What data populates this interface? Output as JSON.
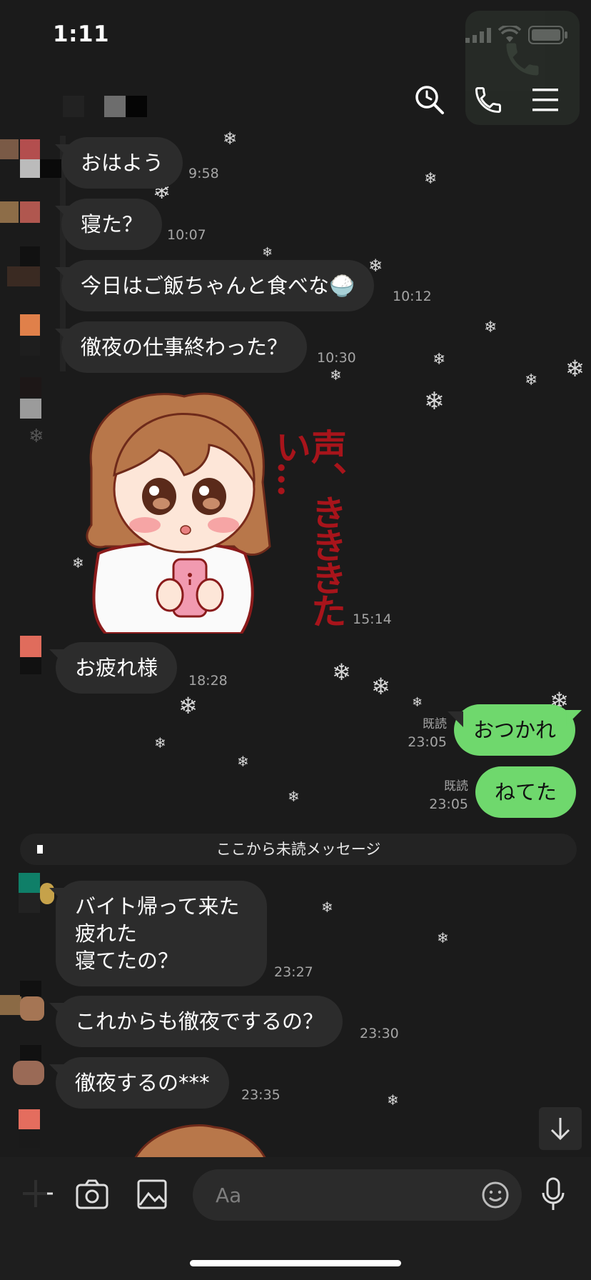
{
  "status_bar": {
    "time": "1:11"
  },
  "chat": {
    "messages_in_top": [
      {
        "text": "おはよう",
        "time": "9:58"
      },
      {
        "text": "寝た？",
        "time": "10:07"
      },
      {
        "text": "今日はご飯ちゃんと食べな🍚",
        "time": "10:12"
      },
      {
        "text": "徹夜の仕事終わった？",
        "time": "10:30"
      }
    ],
    "sticker": {
      "caption": "声、きききたい…",
      "time": "15:14"
    },
    "message_otsukaresama": {
      "text": "お疲れ様",
      "time": "18:28"
    },
    "sent": [
      {
        "text": "おつかれ",
        "read": "既読",
        "time": "23:05"
      },
      {
        "text": "ねてた",
        "read": "既読",
        "time": "23:05"
      }
    ],
    "unread_divider": "ここから未読メッセージ",
    "messages_in_bottom": [
      {
        "text": "バイト帰って来た\n疲れた\n寝てたの？",
        "time": "23:27"
      },
      {
        "text": "これからも徹夜でするの？",
        "time": "23:30"
      },
      {
        "text": "徹夜するの***",
        "time": "23:35"
      }
    ]
  },
  "composer": {
    "placeholder": "Aa"
  },
  "colors": {
    "background": "#1b1b1b",
    "incoming_bubble": "#2c2c2c",
    "outgoing_bubble": "#6fd86d"
  },
  "icons": {
    "header": [
      "search-icon",
      "phone-icon",
      "menu-icon"
    ],
    "composer": [
      "plus-icon",
      "camera-icon",
      "image-icon",
      "emoji-icon",
      "microphone-icon"
    ],
    "scroll": "arrow-down-icon"
  }
}
